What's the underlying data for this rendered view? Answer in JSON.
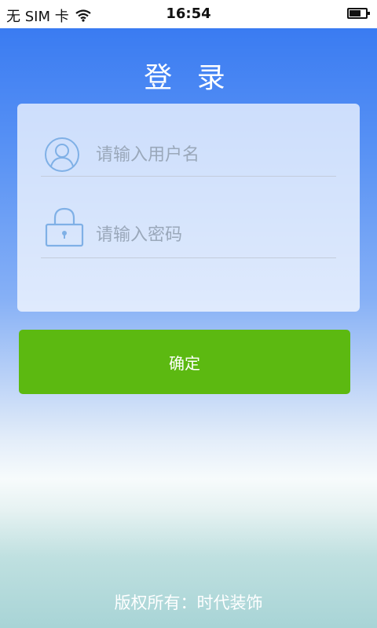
{
  "status_bar": {
    "carrier": "无 SIM 卡",
    "time": "16:54",
    "battery_level": 0.7,
    "icons": [
      "wifi-icon",
      "battery-icon"
    ]
  },
  "page": {
    "title": "登 录"
  },
  "form": {
    "username_placeholder": "请输入用户名",
    "password_placeholder": "请输入密码",
    "username_icon": "user-icon",
    "password_icon": "lock-icon"
  },
  "confirm_label": "确定",
  "footer": {
    "copyright": "版权所有：时代装饰"
  },
  "colors": {
    "button": "#5cb911",
    "icon_stroke": "#7fb0e6",
    "header_blue": "#2a6ff0"
  }
}
